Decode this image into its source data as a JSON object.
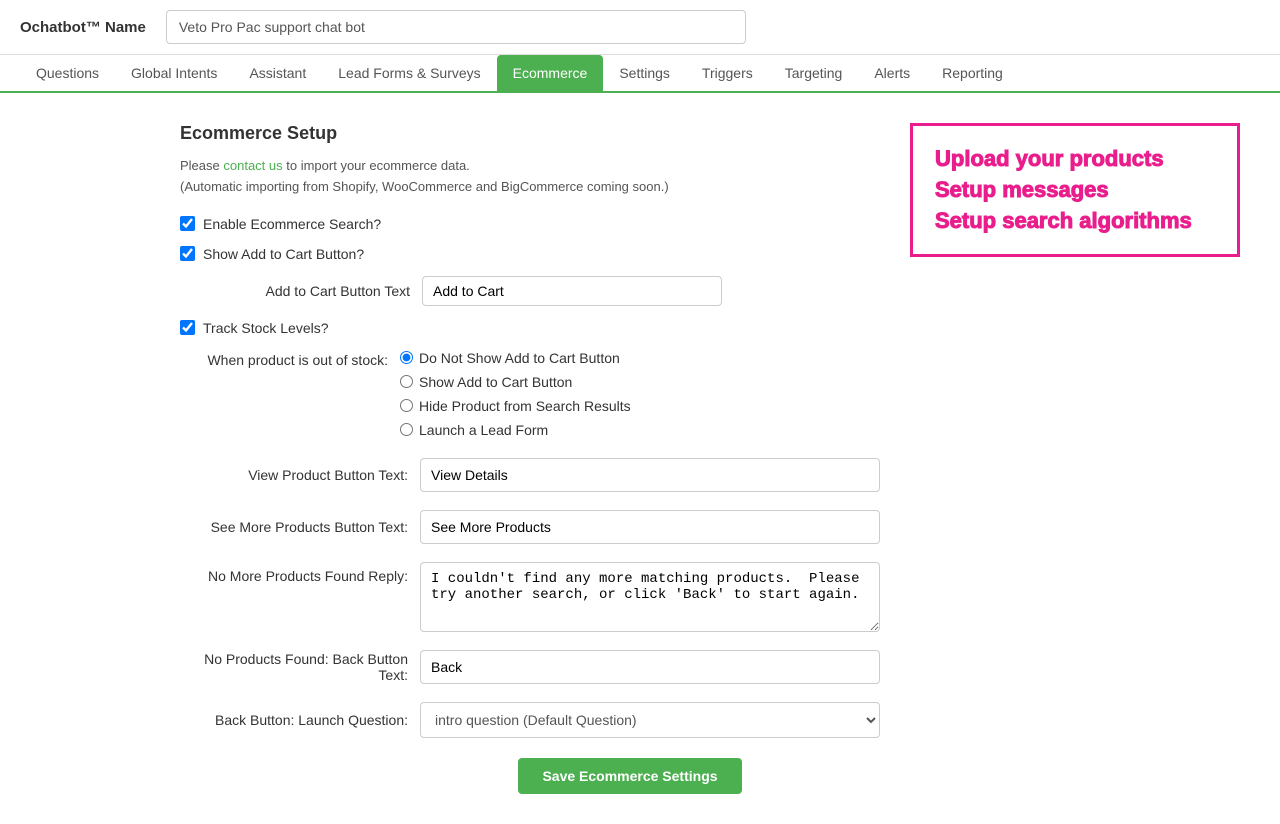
{
  "brand": {
    "name": "Ochatbot™ Name"
  },
  "bot_name_input": {
    "value": "Veto Pro Pac support chat bot"
  },
  "nav": {
    "tabs": [
      {
        "label": "Questions",
        "active": false
      },
      {
        "label": "Global Intents",
        "active": false
      },
      {
        "label": "Assistant",
        "active": false
      },
      {
        "label": "Lead Forms & Surveys",
        "active": false
      },
      {
        "label": "Ecommerce",
        "active": true
      },
      {
        "label": "Settings",
        "active": false
      },
      {
        "label": "Triggers",
        "active": false
      },
      {
        "label": "Targeting",
        "active": false
      },
      {
        "label": "Alerts",
        "active": false
      },
      {
        "label": "Reporting",
        "active": false
      }
    ]
  },
  "ecommerce": {
    "section_title": "Ecommerce Setup",
    "intro_line1": "Please",
    "contact_us_text": "contact us",
    "intro_line2": "to import your ecommerce data.",
    "intro_line3": "(Automatic importing from Shopify, WooCommerce and BigCommerce coming soon.)",
    "promo": {
      "line1": "Upload your products",
      "line2": "Setup messages",
      "line3": "Setup search algorithms"
    },
    "enable_ecommerce_label": "Enable Ecommerce Search?",
    "show_add_to_cart_label": "Show Add to Cart Button?",
    "add_to_cart_btn_text_label": "Add to Cart Button Text",
    "add_to_cart_btn_text_value": "Add to Cart",
    "track_stock_label": "Track Stock Levels?",
    "out_of_stock_label": "When product is out of stock:",
    "out_of_stock_options": [
      {
        "label": "Do Not Show Add to Cart Button",
        "value": "dont_show",
        "selected": true
      },
      {
        "label": "Show Add to Cart Button",
        "value": "show",
        "selected": false
      },
      {
        "label": "Hide Product from Search Results",
        "value": "hide",
        "selected": false
      },
      {
        "label": "Launch a Lead Form",
        "value": "lead_form",
        "selected": false
      }
    ],
    "view_product_btn_label": "View Product Button Text:",
    "view_product_btn_value": "View Details",
    "see_more_btn_label": "See More Products Button Text:",
    "see_more_btn_value": "See More Products",
    "no_more_products_label": "No More Products Found Reply:",
    "no_more_products_value": "I couldn't find any more matching products.  Please try another search, or click 'Back' to start again.",
    "no_products_back_label": "No Products Found: Back Button Text:",
    "no_products_back_value": "Back",
    "back_btn_launch_label": "Back Button: Launch Question:",
    "back_btn_launch_value": "intro question (Default Question)",
    "save_btn_label": "Save Ecommerce Settings"
  }
}
